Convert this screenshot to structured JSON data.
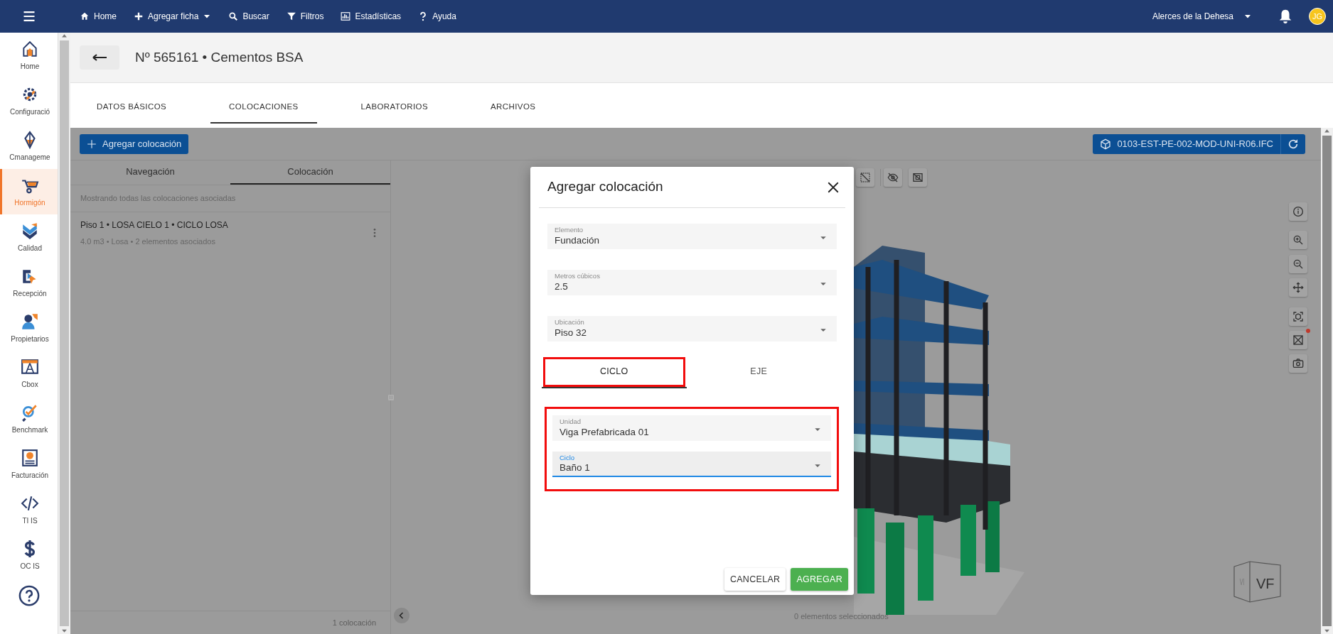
{
  "top_nav": {
    "items": [
      {
        "label": "Home",
        "dropdown": false
      },
      {
        "label": "Agregar ficha",
        "dropdown": true
      },
      {
        "label": "Buscar",
        "dropdown": false
      },
      {
        "label": "Filtros",
        "dropdown": false
      },
      {
        "label": "Estadísticas",
        "dropdown": false
      },
      {
        "label": "Ayuda",
        "dropdown": false
      }
    ],
    "project": "Alerces de la Dehesa",
    "user_initials": "JG"
  },
  "sidebar": {
    "items": [
      {
        "label": "Home",
        "selected": false
      },
      {
        "label": "Configuració",
        "selected": false
      },
      {
        "label": "Cmanageme",
        "selected": false
      },
      {
        "label": "Hormigón",
        "selected": true
      },
      {
        "label": "Calidad",
        "selected": false
      },
      {
        "label": "Recepción",
        "selected": false
      },
      {
        "label": "Propietarios",
        "selected": false
      },
      {
        "label": "Cbox",
        "selected": false
      },
      {
        "label": "Benchmark",
        "selected": false
      },
      {
        "label": "Facturación",
        "selected": false
      },
      {
        "label": "TI IS",
        "selected": false
      },
      {
        "label": "OC IS",
        "selected": false
      }
    ]
  },
  "record": {
    "title": "Nº 565161 • Cementos BSA"
  },
  "tabs": [
    {
      "label": "DATOS BÁSICOS",
      "selected": false
    },
    {
      "label": "COLOCACIONES",
      "selected": true
    },
    {
      "label": "LABORATORIOS",
      "selected": false
    },
    {
      "label": "ARCHIVOS",
      "selected": false
    }
  ],
  "toolbar": {
    "add_button": "Agregar colocación",
    "model_file": "0103-EST-PE-002-MOD-UNI-R06.IFC"
  },
  "panel": {
    "tabs": [
      {
        "label": "Navegación",
        "selected": false
      },
      {
        "label": "Colocación",
        "selected": true
      }
    ],
    "caption": "Mostrando todas las colocaciones asociadas",
    "items": [
      {
        "title": "Piso 1 • LOSA CIELO 1 • CICLO LOSA",
        "details": "4.0 m3 • Losa • 2 elementos asociados"
      }
    ],
    "footer": "1 colocación"
  },
  "viewer": {
    "selection_status": "0 elementos seleccionados",
    "view_cube": [
      "VI",
      "VF"
    ]
  },
  "dialog": {
    "title": "Agregar colocación",
    "fields": [
      {
        "label": "Elemento",
        "value": "Fundación"
      },
      {
        "label": "Metros cúbicos",
        "value": "2.5"
      },
      {
        "label": "Ubicación",
        "value": "Piso 32"
      }
    ],
    "tabs": [
      {
        "label": "CICLO",
        "selected": true,
        "highlighted": true
      },
      {
        "label": "EJE",
        "selected": false,
        "highlighted": false
      }
    ],
    "cycle_group": {
      "highlighted": true,
      "fields": [
        {
          "label": "Unidad",
          "value": "Viga Prefabricada 01",
          "focused": false
        },
        {
          "label": "Ciclo",
          "value": "Baño 1",
          "focused": true
        }
      ]
    },
    "buttons": [
      {
        "label": "CANCELAR",
        "kind": "secondary"
      },
      {
        "label": "AGREGAR",
        "kind": "primary"
      }
    ]
  }
}
